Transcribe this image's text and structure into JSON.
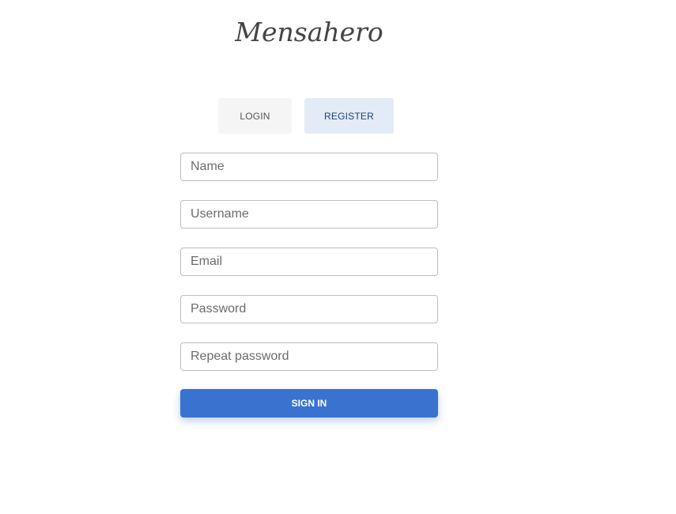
{
  "app": {
    "title": "Mensahero"
  },
  "tabs": {
    "login_label": "LOGIN",
    "register_label": "REGISTER",
    "active": "register"
  },
  "register_form": {
    "name_placeholder": "Name",
    "username_placeholder": "Username",
    "email_placeholder": "Email",
    "password_placeholder": "Password",
    "repeat_password_placeholder": "Repeat password",
    "submit_label": "SIGN IN"
  },
  "colors": {
    "primary": "#3a72cf",
    "active_tab_bg": "#e3ebf7",
    "inactive_tab_bg": "#f5f5f5",
    "active_tab_text": "#1e3f7a"
  }
}
